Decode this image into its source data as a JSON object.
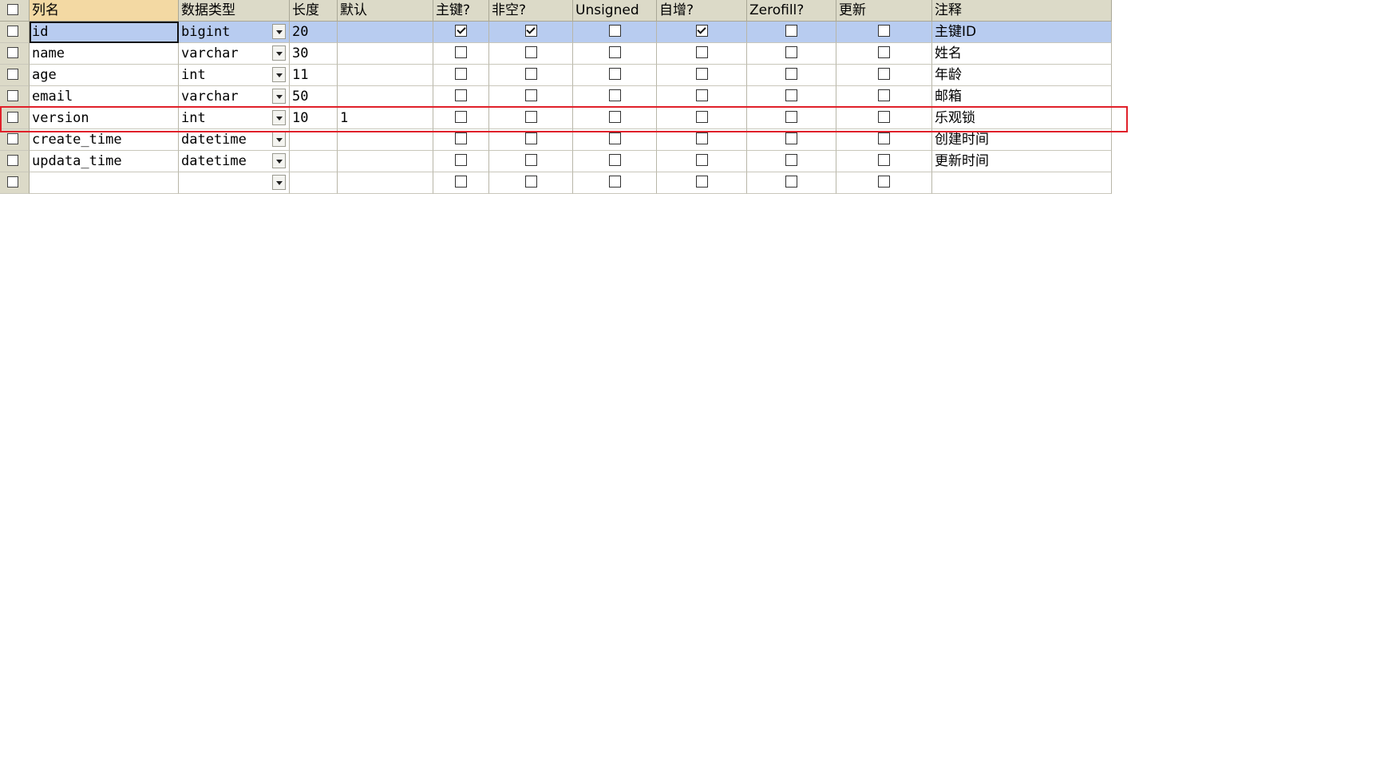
{
  "columns": {
    "name": "列名",
    "type": "数据类型",
    "length": "长度",
    "default": "默认",
    "primary_key": "主键?",
    "not_null": "非空?",
    "unsigned": "Unsigned",
    "auto_increment": "自增?",
    "zerofill": "Zerofill?",
    "update": "更新",
    "comment": "注释"
  },
  "rows": [
    {
      "name": "id",
      "type": "bigint",
      "length": "20",
      "default": "",
      "pk": true,
      "nn": true,
      "unsigned": false,
      "ai": true,
      "zf": false,
      "upd": false,
      "comment": "主键ID",
      "selected": true
    },
    {
      "name": "name",
      "type": "varchar",
      "length": "30",
      "default": "",
      "pk": false,
      "nn": false,
      "unsigned": false,
      "ai": false,
      "zf": false,
      "upd": false,
      "comment": "姓名"
    },
    {
      "name": "age",
      "type": "int",
      "length": "11",
      "default": "",
      "pk": false,
      "nn": false,
      "unsigned": false,
      "ai": false,
      "zf": false,
      "upd": false,
      "comment": "年龄"
    },
    {
      "name": "email",
      "type": "varchar",
      "length": "50",
      "default": "",
      "pk": false,
      "nn": false,
      "unsigned": false,
      "ai": false,
      "zf": false,
      "upd": false,
      "comment": "邮箱"
    },
    {
      "name": "version",
      "type": "int",
      "length": "10",
      "default": "1",
      "pk": false,
      "nn": false,
      "unsigned": false,
      "ai": false,
      "zf": false,
      "upd": false,
      "comment": "乐观锁",
      "highlighted": true
    },
    {
      "name": "create_time",
      "type": "datetime",
      "length": "",
      "default": "",
      "pk": false,
      "nn": false,
      "unsigned": false,
      "ai": false,
      "zf": false,
      "upd": false,
      "comment": "创建时间"
    },
    {
      "name": "updata_time",
      "type": "datetime",
      "length": "",
      "default": "",
      "pk": false,
      "nn": false,
      "unsigned": false,
      "ai": false,
      "zf": false,
      "upd": false,
      "comment": "更新时间"
    },
    {
      "name": "",
      "type": "",
      "length": "",
      "default": "",
      "pk": false,
      "nn": false,
      "unsigned": false,
      "ai": false,
      "zf": false,
      "upd": false,
      "comment": ""
    }
  ],
  "colors": {
    "header_bg": "#dcdac8",
    "sorted_header_bg": "#f3d9a3",
    "selected_row_bg": "#b8ccf0",
    "highlight_border": "#e0202a"
  }
}
